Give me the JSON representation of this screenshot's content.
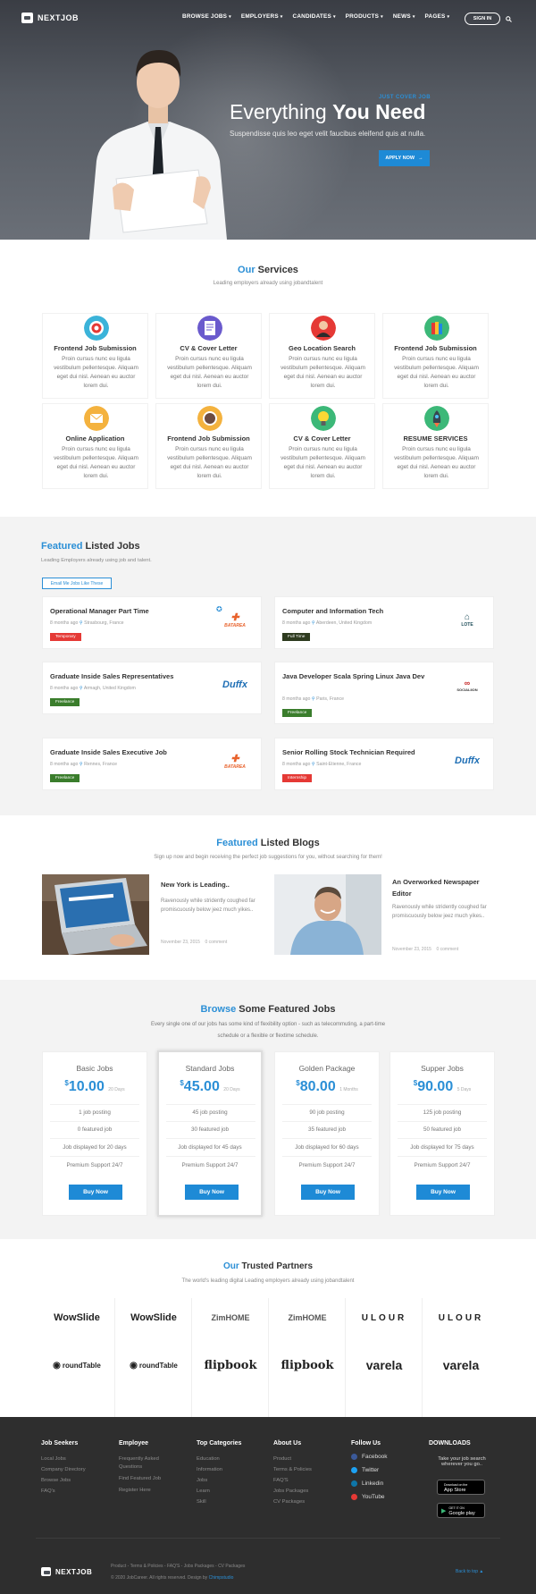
{
  "brand": {
    "name": "NEXTJOB"
  },
  "nav": {
    "items": [
      "BROWSE JOBS",
      "EMPLOYERS",
      "CANDIDATES",
      "PRODUCTS",
      "NEWS",
      "PAGES"
    ],
    "signin": "SIGN IN"
  },
  "hero": {
    "kicker": "JUST COVER JOB",
    "title_plain": "Everything ",
    "title_bold": "You Need",
    "subtitle": "Suspendisse quis leo eget velit faucibus eleifend quis at nulla.",
    "apply": "APPLY NOW"
  },
  "services": {
    "title_hl": "Our",
    "title_rest": " Services",
    "subtitle": "Leading employers already using jobandtalent",
    "items": [
      {
        "title": "Frontend Job Submission",
        "text": "Proin cursus nunc eu ligula vestibulum pellentesque. Aliquam eget dui nisl. Aenean eu auctor lorem dui.",
        "icon": "target-icon"
      },
      {
        "title": "CV & Cover Letter",
        "text": "Proin cursus nunc eu ligula vestibulum pellentesque. Aliquam eget dui nisl. Aenean eu auctor lorem dui.",
        "icon": "document-icon"
      },
      {
        "title": "Geo Location Search",
        "text": "Proin cursus nunc eu ligula vestibulum pellentesque. Aliquam eget dui nisl. Aenean eu auctor lorem dui.",
        "icon": "person-icon"
      },
      {
        "title": "Frontend Job Submission",
        "text": "Proin cursus nunc eu ligula vestibulum pellentesque. Aliquam eget dui nisl. Aenean eu auctor lorem dui.",
        "icon": "books-icon"
      },
      {
        "title": "Online Application",
        "text": "Proin cursus nunc eu ligula vestibulum pellentesque. Aliquam eget dui nisl. Aenean eu auctor lorem dui.",
        "icon": "envelope-icon"
      },
      {
        "title": "Frontend Job Submission",
        "text": "Proin cursus nunc eu ligula vestibulum pellentesque. Aliquam eget dui nisl. Aenean eu auctor lorem dui.",
        "icon": "coffee-icon"
      },
      {
        "title": "CV & Cover Letter",
        "text": "Proin cursus nunc eu ligula vestibulum pellentesque. Aliquam eget dui nisl. Aenean eu auctor lorem dui.",
        "icon": "lightbulb-icon"
      },
      {
        "title": "RESUME SERVICES",
        "text": "Proin cursus nunc eu ligula vestibulum pellentesque. Aliquam eget dui nisl. Aenean eu auctor lorem dui.",
        "icon": "rocket-icon"
      }
    ]
  },
  "jobs": {
    "title_hl": "Featured",
    "title_rest": " Listed Jobs",
    "subtitle": "Leading Employers already using job and talent.",
    "email_alert": "Email Me Jobs Like These",
    "items": [
      {
        "title": "Operational Manager Part Time",
        "ago": "8 months ago",
        "loc": "Strasbourg, France",
        "badge": "Temporary",
        "badge_color": "#e53935",
        "company": "BATAREA"
      },
      {
        "title": "Computer and Information Tech",
        "ago": "8 months ago",
        "loc": "Aberdeen, United Kingdom",
        "badge": "Full Time",
        "badge_color": "#2e3b1f",
        "company": "LOTE"
      },
      {
        "title": "Graduate Inside Sales Representatives",
        "ago": "8 months ago",
        "loc": "Armagh, United Kingdom",
        "badge": "Freelance",
        "badge_color": "#3a7d2c",
        "company": "Duffx"
      },
      {
        "title": "Java Developer Scala Spring Linux Java Dev",
        "ago": "8 months ago",
        "loc": "Paris, France",
        "badge": "Freelance",
        "badge_color": "#3a7d2c",
        "company": "SOCIALIION"
      },
      {
        "title": "Graduate Inside Sales Executive Job",
        "ago": "8 months ago",
        "loc": "Rennes, France",
        "badge": "Freelance",
        "badge_color": "#3a7d2c",
        "company": "BATAREA"
      },
      {
        "title": "Senior Rolling Stock Technician Required",
        "ago": "8 months ago",
        "loc": "Saint-Etienne, France",
        "badge": "Internship",
        "badge_color": "#e53935",
        "company": "Duffx"
      }
    ]
  },
  "blogs": {
    "title_hl": "Featured",
    "title_rest": " Listed Blogs",
    "subtitle": "Sign up now and begin receiving the perfect job suggestions for you, without searching for them!",
    "items": [
      {
        "title": "New York is Leading..",
        "excerpt": "Ravenously while stridently coughed far promiscuously below jeez much yikes..",
        "date": "November 23, 2015",
        "comments": "0 comment"
      },
      {
        "title": "An Overworked Newspaper Editor",
        "excerpt": "Ravenously while stridently coughed far promiscuously below jeez much yikes..",
        "date": "November 23, 2015",
        "comments": "0 comment"
      }
    ]
  },
  "pricing": {
    "title_hl": "Browse",
    "title_rest": " Some Featured Jobs",
    "subtitle_1": "Every single one of our jobs has some kind of flexibility option - such as telecommuting, a part-time",
    "subtitle_2": "schedule or a flexible or flextime schedule.",
    "plans": [
      {
        "name": "Basic Jobs",
        "price": "10.00",
        "period": "20 Days",
        "f1": "1 job posting",
        "f2": "0 featured job",
        "f3": "Job displayed for 20 days",
        "f4": "Premium Support 24/7",
        "buy": "Buy Now"
      },
      {
        "name": "Standard Jobs",
        "price": "45.00",
        "period": "20 Days",
        "f1": "45 job posting",
        "f2": "30 featured job",
        "f3": "Job displayed for 45 days",
        "f4": "Premium Support 24/7",
        "buy": "Buy Now"
      },
      {
        "name": "Golden Package",
        "price": "80.00",
        "period": "1 Months",
        "f1": "90 job posting",
        "f2": "35 featured job",
        "f3": "Job displayed for 60 days",
        "f4": "Premium Support 24/7",
        "buy": "Buy Now"
      },
      {
        "name": "Supper Jobs",
        "price": "90.00",
        "period": "5 Days",
        "f1": "125 job posting",
        "f2": "50 featured job",
        "f3": "Job displayed for 75 days",
        "f4": "Premium Support 24/7",
        "buy": "Buy Now"
      }
    ]
  },
  "partners": {
    "title_hl": "Our",
    "title_rest": " Trusted Partners",
    "subtitle": "The world's leading digital Leading employers already using jobandtalent",
    "logos": [
      "WowSlide",
      "WowSlide",
      "ZimHOME",
      "ZimHOME",
      "ULOUR",
      "ULOUR",
      "roundTable",
      "roundTable",
      "flipbook",
      "flipbook",
      "varela",
      "varela"
    ]
  },
  "footer": {
    "cols": [
      {
        "title": "Job Seekers",
        "links": [
          "Local Jobs",
          "Company Directory",
          "Browse Jobs",
          "FAQ's"
        ]
      },
      {
        "title": "Employee",
        "links": [
          "Frequently Asked",
          "Questions",
          "Find Featured Job",
          "Register Here"
        ]
      },
      {
        "title": "Top Categories",
        "links": [
          "Education",
          "Information",
          "Jobs",
          "Learn",
          "Skill"
        ]
      },
      {
        "title": "About Us",
        "links": [
          "Product",
          "Terms & Policies",
          "FAQ'S",
          "Jobs Packages",
          "CV Packages"
        ]
      }
    ],
    "follow_title": "Follow Us",
    "social": [
      "Facebook",
      "Twitter",
      "Linkedin",
      "YouTube"
    ],
    "downloads_title": "DOWNLOADS",
    "downloads_text_1": "Take your job search",
    "downloads_text_2": "wherever you go..",
    "app_store": "App Store",
    "app_store_small": "Download on the",
    "google_play": "Google play",
    "google_play_small": "GET IT ON",
    "bottom_links": "Product  -  Terms & Policies  -  FAQ'S  -  Jobs Packages  -  CV Packages",
    "copyright_1": "© 2020 JobCareer. All rights reserved. Design by",
    "copyright_hl": "Chimpstudio",
    "back_to_top": "Back to top"
  },
  "colors": {
    "accent": "#2b8fd6",
    "button": "#1e8ad6",
    "footer": "#2e2e2e"
  }
}
